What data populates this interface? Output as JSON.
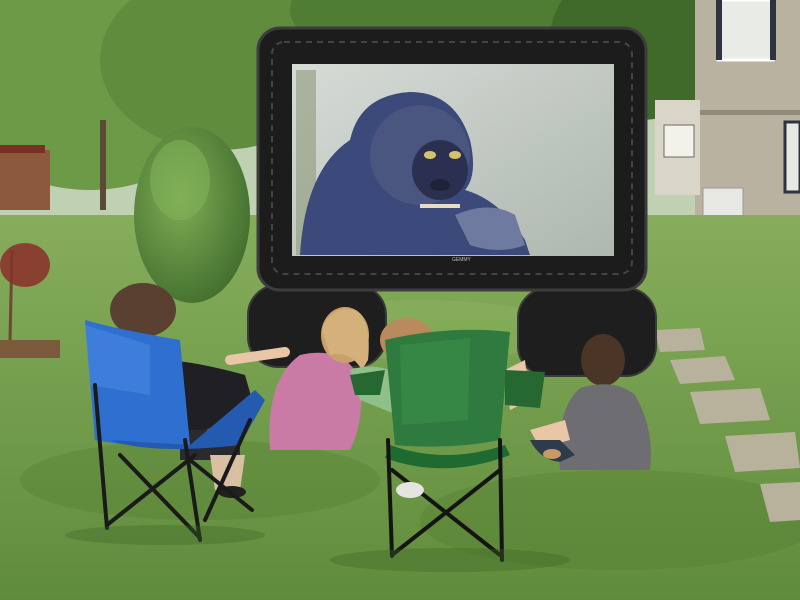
{
  "scene": {
    "type": "photo",
    "screen_brand_text": "GEMMY",
    "colors": {
      "sky": "#c9d7c0",
      "lawn": "#6f9a4a",
      "lawn_dark": "#577f35",
      "screen_frame": "#1c1c1c",
      "house_siding": "#b9b2a0",
      "blue_chair": "#2f6fd0",
      "green_chair": "#2f7a3e"
    }
  }
}
